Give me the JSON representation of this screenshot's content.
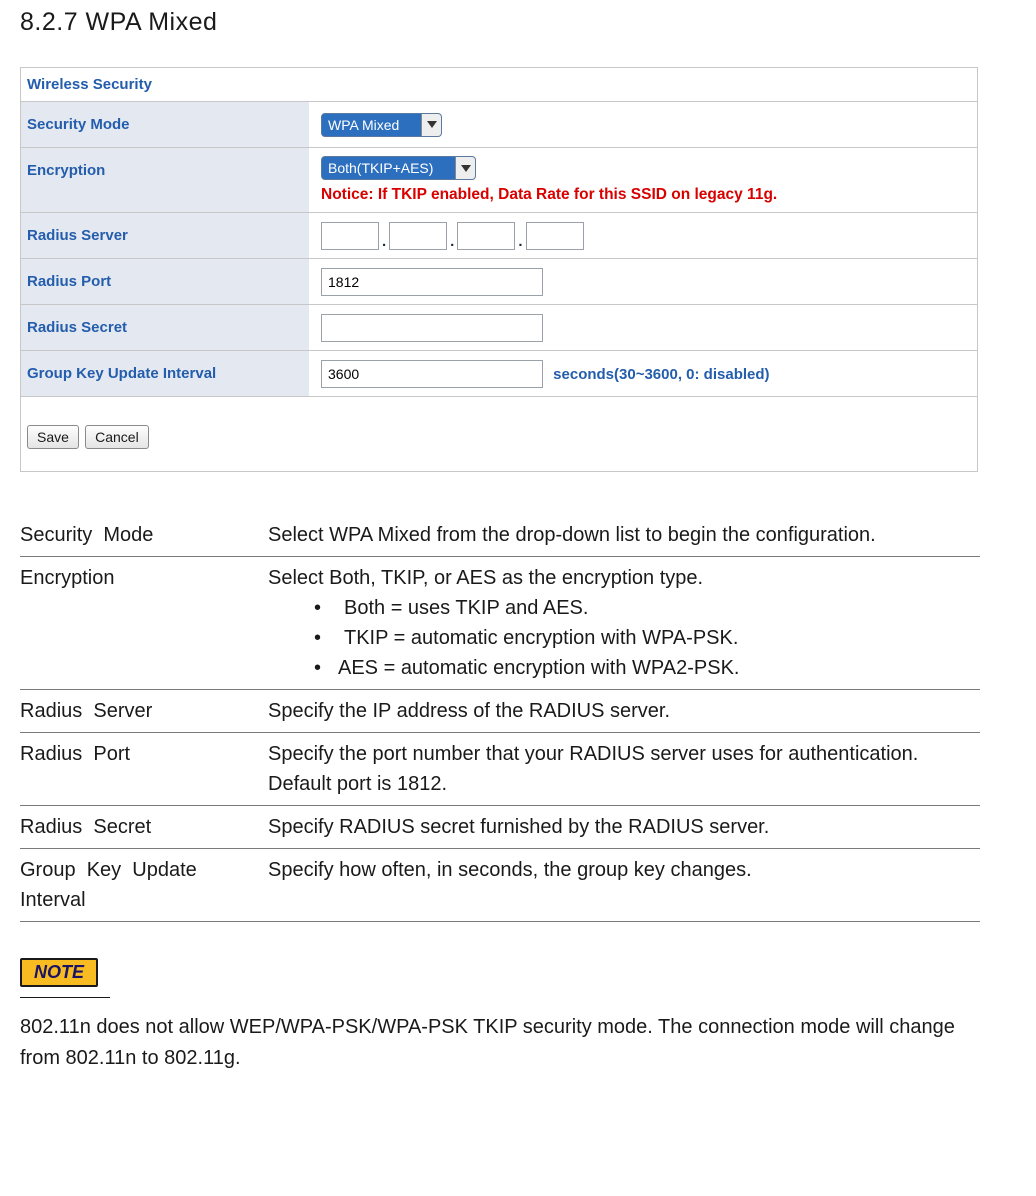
{
  "heading": "8.2.7  WPA  Mixed",
  "panel": {
    "title": "Wireless Security",
    "rows": {
      "security_mode": {
        "label": "Security Mode",
        "value": "WPA Mixed"
      },
      "encryption": {
        "label": "Encryption",
        "value": "Both(TKIP+AES)",
        "notice": "Notice: If TKIP enabled, Data Rate for this SSID on legacy 11g."
      },
      "radius_server": {
        "label": "Radius Server",
        "octets": [
          "",
          "",
          "",
          ""
        ]
      },
      "radius_port": {
        "label": "Radius Port",
        "value": "1812"
      },
      "radius_secret": {
        "label": "Radius Secret",
        "value": ""
      },
      "group_key": {
        "label": "Group Key Update Interval",
        "value": "3600",
        "suffix": "seconds(30~3600, 0: disabled)"
      }
    },
    "buttons": {
      "save": "Save",
      "cancel": "Cancel"
    }
  },
  "desc": [
    {
      "term": "Security  Mode",
      "text": "Select WPA  Mixed  from the drop-down list to begin the configuration."
    },
    {
      "term": "Encryption",
      "intro": "Select Both,  TKIP,  or AES  as the encryption type.",
      "bullets": [
        "Both  = uses TKIP and AES.",
        "TKIP  = automatic encryption with WPA-PSK.",
        "AES  = automatic encryption with WPA2-PSK."
      ]
    },
    {
      "term": "Radius  Server",
      "text": "Specify the IP address of the RADIUS server."
    },
    {
      "term": "Radius  Port",
      "text": "Specify the port number that your RADIUS server uses for authentication. Default port is 1812."
    },
    {
      "term": "Radius  Secret",
      "text": "Specify RADIUS secret furnished by the RADIUS server."
    },
    {
      "term": "Group  Key  Update Interval",
      "text": "Specify how often, in seconds, the group key changes."
    }
  ],
  "note": {
    "badge": "NOTE",
    "text": "802.11n does not allow WEP/WPA-PSK/WPA-PSK  TKIP security mode. The connection mode will change from 802.11n to 802.11g."
  }
}
